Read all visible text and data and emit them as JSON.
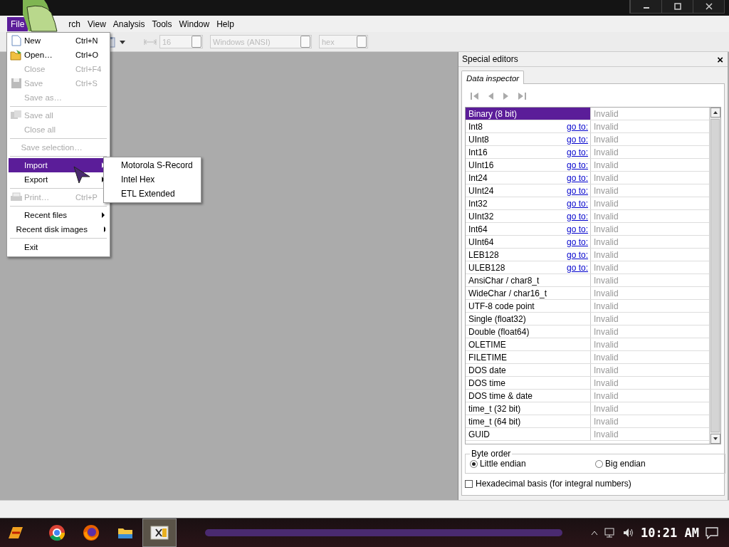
{
  "window": {
    "buttons": [
      {
        "kind": "minimize"
      },
      {
        "kind": "maximize"
      },
      {
        "kind": "close"
      }
    ]
  },
  "menu_bar": [
    {
      "label": "File",
      "selected": true
    },
    {
      "label": "rch",
      "selected": false
    },
    {
      "label": "View",
      "selected": false
    },
    {
      "label": "Analysis",
      "selected": false
    },
    {
      "label": "Tools",
      "selected": false
    },
    {
      "label": "Window",
      "selected": false
    },
    {
      "label": "Help",
      "selected": false
    }
  ],
  "toolbar": {
    "bytes_per_row": "16",
    "charset": "Windows (ANSI)",
    "offset_base": "hex"
  },
  "file_menu": [
    {
      "kind": "item",
      "label": "New",
      "shortcut": "Ctrl+N",
      "disabled": false,
      "selected": false,
      "submenu": false
    },
    {
      "kind": "item",
      "label": "Open…",
      "shortcut": "Ctrl+O",
      "disabled": false,
      "selected": false,
      "submenu": false
    },
    {
      "kind": "item",
      "label": "Close",
      "shortcut": "Ctrl+F4",
      "disabled": true,
      "selected": false,
      "submenu": false
    },
    {
      "kind": "item",
      "label": "Save",
      "shortcut": "Ctrl+S",
      "disabled": true,
      "selected": false,
      "submenu": false
    },
    {
      "kind": "item",
      "label": "Save as…",
      "disabled": true,
      "selected": false,
      "submenu": false
    },
    {
      "kind": "separator"
    },
    {
      "kind": "item",
      "label": "Save all",
      "disabled": true,
      "selected": false,
      "submenu": false
    },
    {
      "kind": "item",
      "label": "Close all",
      "disabled": true,
      "selected": false,
      "submenu": false
    },
    {
      "kind": "separator"
    },
    {
      "kind": "item",
      "label": "Save selection…",
      "disabled": true,
      "selected": false,
      "submenu": false
    },
    {
      "kind": "separator"
    },
    {
      "kind": "item",
      "label": "Import",
      "disabled": false,
      "selected": true,
      "submenu": true
    },
    {
      "kind": "item",
      "label": "Export",
      "disabled": false,
      "selected": false,
      "submenu": true
    },
    {
      "kind": "separator"
    },
    {
      "kind": "item",
      "label": "Print…",
      "shortcut": "Ctrl+P",
      "disabled": true,
      "selected": false,
      "submenu": false
    },
    {
      "kind": "separator"
    },
    {
      "kind": "item",
      "label": "Recent files",
      "disabled": false,
      "selected": false,
      "submenu": true
    },
    {
      "kind": "item",
      "label": "Recent disk images",
      "disabled": false,
      "selected": false,
      "submenu": true
    },
    {
      "kind": "separator"
    },
    {
      "kind": "item",
      "label": "Exit",
      "disabled": false,
      "selected": false,
      "submenu": false
    }
  ],
  "import_submenu": [
    "Motorola S-Record",
    "Intel Hex",
    "ETL Extended"
  ],
  "special_editors": {
    "title": "Special editors",
    "close": "×",
    "tabs": [
      {
        "label": "Data inspector",
        "selected": true
      }
    ],
    "rows": [
      {
        "name": "Binary (8 bit)",
        "value": "Invalid",
        "selected": true
      },
      {
        "name": "Int8",
        "goto": "go to:",
        "value": "Invalid",
        "selected": false
      },
      {
        "name": "UInt8",
        "goto": "go to:",
        "value": "Invalid",
        "selected": false
      },
      {
        "name": "Int16",
        "goto": "go to:",
        "value": "Invalid",
        "selected": false
      },
      {
        "name": "UInt16",
        "goto": "go to:",
        "value": "Invalid",
        "selected": false
      },
      {
        "name": "Int24",
        "goto": "go to:",
        "value": "Invalid",
        "selected": false
      },
      {
        "name": "UInt24",
        "goto": "go to:",
        "value": "Invalid",
        "selected": false
      },
      {
        "name": "Int32",
        "goto": "go to:",
        "value": "Invalid",
        "selected": false
      },
      {
        "name": "UInt32",
        "goto": "go to:",
        "value": "Invalid",
        "selected": false
      },
      {
        "name": "Int64",
        "goto": "go to:",
        "value": "Invalid",
        "selected": false
      },
      {
        "name": "UInt64",
        "goto": "go to:",
        "value": "Invalid",
        "selected": false
      },
      {
        "name": "LEB128",
        "goto": "go to:",
        "value": "Invalid",
        "selected": false
      },
      {
        "name": "ULEB128",
        "goto": "go to:",
        "value": "Invalid",
        "selected": false
      },
      {
        "name": "AnsiChar / char8_t",
        "value": "Invalid",
        "selected": false
      },
      {
        "name": "WideChar / char16_t",
        "value": "Invalid",
        "selected": false
      },
      {
        "name": "UTF-8 code point",
        "value": "Invalid",
        "selected": false
      },
      {
        "name": "Single (float32)",
        "value": "Invalid",
        "selected": false
      },
      {
        "name": "Double (float64)",
        "value": "Invalid",
        "selected": false
      },
      {
        "name": "OLETIME",
        "value": "Invalid",
        "selected": false
      },
      {
        "name": "FILETIME",
        "value": "Invalid",
        "selected": false
      },
      {
        "name": "DOS date",
        "value": "Invalid",
        "selected": false
      },
      {
        "name": "DOS time",
        "value": "Invalid",
        "selected": false
      },
      {
        "name": "DOS time & date",
        "value": "Invalid",
        "selected": false
      },
      {
        "name": "time_t (32 bit)",
        "value": "Invalid",
        "selected": false
      },
      {
        "name": "time_t (64 bit)",
        "value": "Invalid",
        "selected": false
      },
      {
        "name": "GUID",
        "value": "Invalid",
        "selected": false
      }
    ],
    "byte_order": {
      "title": "Byte order",
      "options": [
        {
          "label": "Little endian",
          "selected": true
        },
        {
          "label": "Big endian",
          "selected": false
        }
      ]
    },
    "hex_basis": {
      "label": "Hexadecimal basis (for integral numbers)",
      "checked": false
    }
  },
  "taskbar": {
    "apps": [
      {
        "kind": "start"
      },
      {
        "kind": "chrome",
        "selected": false
      },
      {
        "kind": "firefox",
        "selected": false
      },
      {
        "kind": "folder",
        "selected": false
      },
      {
        "kind": "hxd",
        "selected": true
      }
    ],
    "time": "10:21 AM"
  }
}
